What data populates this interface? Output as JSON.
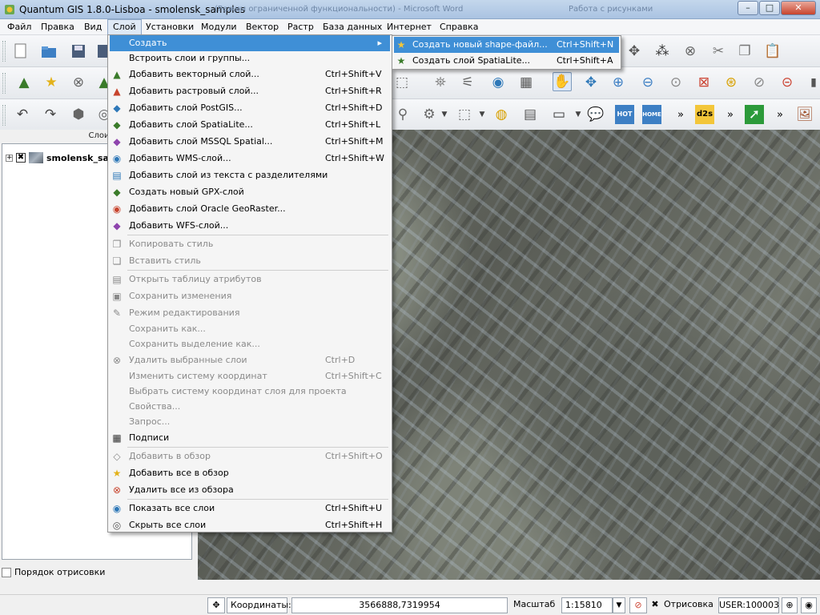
{
  "window": {
    "title": "Quantum GIS 1.8.0-Lisboa - smolensk_samples",
    "background_text_1": "(Режим ограниченной функциональности) - Microsoft Word",
    "background_text_2": "Работа с рисунками",
    "minimize": "–",
    "maximize": "□",
    "close": "✕"
  },
  "menubar": [
    "Файл",
    "Правка",
    "Вид",
    "Слой",
    "Установки",
    "Модули",
    "Вектор",
    "Растр",
    "База данных",
    "Интернет",
    "Справка"
  ],
  "layer_menu": [
    {
      "label": "Создать",
      "shortcut": "",
      "arrow": "▸",
      "icon": ""
    },
    {
      "label": "Встроить слои и группы...",
      "shortcut": "",
      "icon": ""
    },
    {
      "label": "Добавить векторный слой...",
      "shortcut": "Ctrl+Shift+V",
      "icon": "vector-layer-icon"
    },
    {
      "label": "Добавить растровый слой...",
      "shortcut": "Ctrl+Shift+R",
      "icon": "raster-layer-icon"
    },
    {
      "label": "Добавить слой PostGIS...",
      "shortcut": "Ctrl+Shift+D",
      "icon": "postgis-icon"
    },
    {
      "label": "Добавить слой SpatiaLite...",
      "shortcut": "Ctrl+Shift+L",
      "icon": "spatialite-icon"
    },
    {
      "label": "Добавить слой MSSQL Spatial...",
      "shortcut": "Ctrl+Shift+M",
      "icon": "mssql-icon"
    },
    {
      "label": "Добавить WMS-слой...",
      "shortcut": "Ctrl+Shift+W",
      "icon": "wms-icon"
    },
    {
      "label": "Добавить слой из текста с разделителями",
      "shortcut": "",
      "icon": "delimited-text-icon"
    },
    {
      "label": "Создать новый GPX-слой",
      "shortcut": "",
      "icon": "gpx-icon"
    },
    {
      "label": "Добавить слой Oracle GeoRaster...",
      "shortcut": "",
      "icon": "oracle-icon"
    },
    {
      "label": "Добавить WFS-слой...",
      "shortcut": "",
      "icon": "wfs-icon"
    },
    {
      "label": "Копировать стиль",
      "shortcut": "",
      "icon": "copy-style-icon"
    },
    {
      "label": "Вставить стиль",
      "shortcut": "",
      "icon": "paste-style-icon"
    },
    {
      "label": "Открыть таблицу атрибутов",
      "shortcut": "",
      "icon": "attribute-table-icon"
    },
    {
      "label": "Сохранить изменения",
      "shortcut": "",
      "icon": "save-edits-icon"
    },
    {
      "label": "Режим редактирования",
      "shortcut": "",
      "icon": "pencil-icon"
    },
    {
      "label": "Сохранить как...",
      "shortcut": "",
      "icon": ""
    },
    {
      "label": "Сохранить выделение как...",
      "shortcut": "",
      "icon": ""
    },
    {
      "label": "Удалить выбранные слои",
      "shortcut": "Ctrl+D",
      "icon": "remove-layer-icon"
    },
    {
      "label": "Изменить систему координат",
      "shortcut": "Ctrl+Shift+C",
      "icon": ""
    },
    {
      "label": "Выбрать систему координат слоя для проекта",
      "shortcut": "",
      "icon": ""
    },
    {
      "label": "Свойства...",
      "shortcut": "",
      "icon": ""
    },
    {
      "label": "Запрос...",
      "shortcut": "",
      "icon": ""
    },
    {
      "label": "Подписи",
      "shortcut": "",
      "icon": "labeling-icon"
    },
    {
      "label": "Добавить в обзор",
      "shortcut": "Ctrl+Shift+O",
      "icon": "add-overview-icon"
    },
    {
      "label": "Добавить все в обзор",
      "shortcut": "",
      "icon": "add-all-overview-icon"
    },
    {
      "label": "Удалить все из обзора",
      "shortcut": "",
      "icon": "remove-all-overview-icon"
    },
    {
      "label": "Показать все слои",
      "shortcut": "Ctrl+Shift+U",
      "icon": "show-all-icon"
    },
    {
      "label": "Скрыть все слои",
      "shortcut": "Ctrl+Shift+H",
      "icon": "hide-all-icon"
    }
  ],
  "create_submenu": [
    {
      "label": "Создать новый shape-файл...",
      "shortcut": "Ctrl+Shift+N",
      "icon": "new-shapefile-icon"
    },
    {
      "label": "Создать слой SpatiaLite...",
      "shortcut": "Ctrl+Shift+A",
      "icon": "new-spatialite-icon"
    }
  ],
  "layers_panel": {
    "title": "Слои",
    "layer_name": "smolensk_sa",
    "expand": "+",
    "checkbox": "✖",
    "render_order_label": "Порядок отрисовки"
  },
  "statusbar": {
    "coords_label": "Координаты:",
    "coords_value": "3566888,7319954",
    "scale_label": "Масштаб",
    "scale_value": "1:15810",
    "render_label": "Отрисовка",
    "render_check": "✖",
    "crs": "USER:100003",
    "dropdown": "▼"
  },
  "toolbar_more": "»",
  "toolbar_labels": {
    "hot": "HOT",
    "home": "HOME",
    "d2s": "d2s"
  },
  "colors": {
    "highlight": "#3f8fd6",
    "disabled": "#8a8a8a",
    "titlebar": "#c4d7ec"
  }
}
